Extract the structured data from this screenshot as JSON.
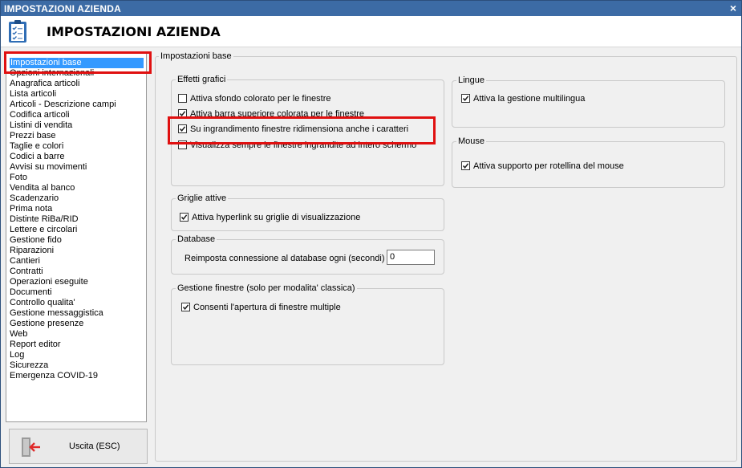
{
  "window": {
    "title": "IMPOSTAZIONI AZIENDA",
    "close_glyph": "×"
  },
  "header": {
    "title": "IMPOSTAZIONI AZIENDA",
    "icon": "clipboard-checklist-icon"
  },
  "nav": {
    "items": [
      "Impostazioni base",
      "Opzioni internazionali",
      "Anagrafica articoli",
      "Lista articoli",
      "Articoli - Descrizione campi",
      "Codifica articoli",
      "Listini di vendita",
      "Prezzi base",
      "Taglie e colori",
      "Codici a barre",
      "Avvisi su movimenti",
      "Foto",
      "Vendita al banco",
      "Scadenzario",
      "Prima nota",
      "Distinte RiBa/RID",
      "Lettere e circolari",
      "Gestione fido",
      "Riparazioni",
      "Cantieri",
      "Contratti",
      "Operazioni eseguite",
      "Documenti",
      "Controllo qualita'",
      "Gestione messaggistica",
      "Gestione presenze",
      "Web",
      "Report editor",
      "Log",
      "Sicurezza",
      "Emergenza COVID-19"
    ],
    "selected": "Impostazioni base"
  },
  "exit_button": {
    "label": "Uscita (ESC)",
    "icon": "exit-door-icon"
  },
  "panel": {
    "title": "Impostazioni base",
    "effetti": {
      "title": "Effetti grafici",
      "options": [
        {
          "label": "Attiva sfondo colorato per le finestre",
          "checked": false
        },
        {
          "label": "Attiva barra superiore colorata per le finestre",
          "checked": true
        },
        {
          "label": "Su ingrandimento finestre ridimensiona anche i caratteri",
          "checked": true
        },
        {
          "label": "Visualizza sempre le finestre ingrandite ad intero schermo",
          "checked": false
        }
      ]
    },
    "griglie": {
      "title": "Griglie attive",
      "option": {
        "label": "Attiva hyperlink su griglie di visualizzazione",
        "checked": true
      }
    },
    "database": {
      "title": "Database",
      "label": "Reimposta connessione al database ogni (secondi) :",
      "value": "0"
    },
    "gestione": {
      "title": "Gestione finestre (solo per modalita' classica)",
      "option": {
        "label": "Consenti l'apertura di finestre multiple",
        "checked": true
      }
    },
    "lingue": {
      "title": "Lingue",
      "option": {
        "label": "Attiva la gestione multilingua",
        "checked": true
      }
    },
    "mouse": {
      "title": "Mouse",
      "option": {
        "label": "Attiva supporto per rotellina del mouse",
        "checked": true
      }
    }
  },
  "colors": {
    "titlebar": "#3c6ba5",
    "selection": "#3399ff",
    "highlight_box": "#e01010"
  }
}
